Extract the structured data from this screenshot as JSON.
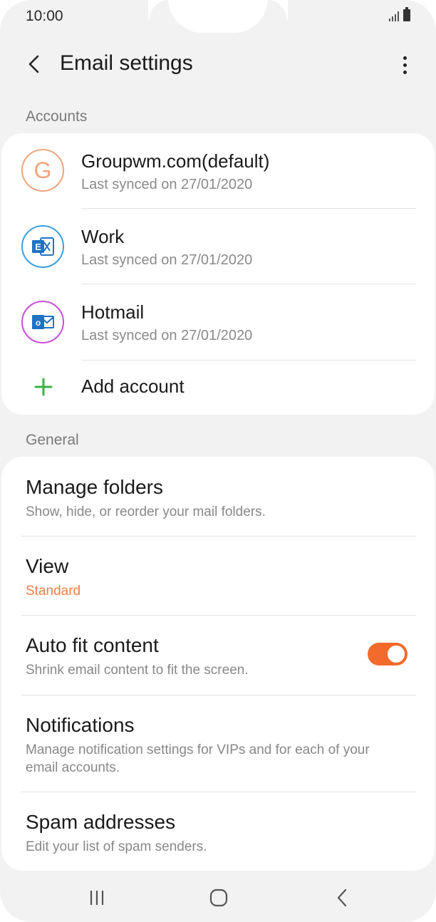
{
  "status_bar": {
    "time": "10:00"
  },
  "app_bar": {
    "title": "Email settings",
    "back_icon": "back-arrow-icon",
    "more_icon": "more-vert-icon"
  },
  "accounts": {
    "header": "Accounts",
    "items": [
      {
        "name": "Groupwm.com(default)",
        "sync": "Last synced on 27/01/2020",
        "icon": "google-letter-icon",
        "letter": "G",
        "color": "#f0a57c"
      },
      {
        "name": "Work",
        "sync": "Last synced on 27/01/2020",
        "icon": "exchange-icon",
        "color": "#3aa0e0"
      },
      {
        "name": "Hotmail",
        "sync": "Last synced on 27/01/2020",
        "icon": "outlook-icon",
        "color": "#c94fd8"
      }
    ],
    "add_label": "Add account"
  },
  "general": {
    "header": "General",
    "items": [
      {
        "title": "Manage folders",
        "sub": "Show, hide, or reorder your mail folders."
      },
      {
        "title": "View",
        "sub": "Standard"
      },
      {
        "title": "Auto fit content",
        "sub": "Shrink email content to fit the screen.",
        "toggle_on": true
      },
      {
        "title": "Notifications",
        "sub": "Manage notification settings for VIPs and for each of your email accounts."
      },
      {
        "title": "Spam addresses",
        "sub": "Edit your list of spam senders."
      }
    ]
  },
  "colors": {
    "accent": "#f26b2c",
    "add_green": "#3cb043"
  },
  "nav": {
    "recents_icon": "recents-icon",
    "home_icon": "home-icon",
    "back_icon": "nav-back-icon"
  }
}
